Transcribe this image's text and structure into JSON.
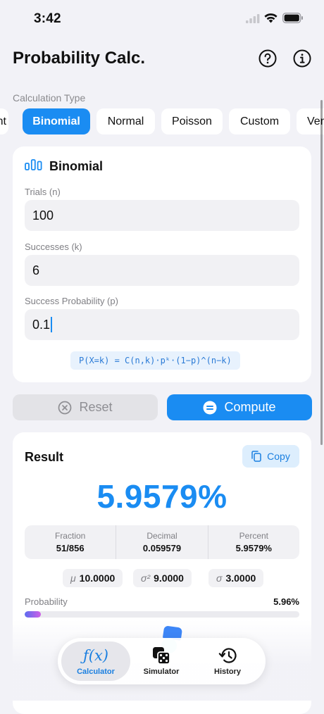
{
  "status_bar": {
    "time": "3:42"
  },
  "header": {
    "title": "Probability Calc."
  },
  "calc_type": {
    "label": "Calculation Type",
    "tabs": [
      "nt",
      "Binomial",
      "Normal",
      "Poisson",
      "Custom",
      "Ven"
    ],
    "selected": "Binomial"
  },
  "input_card": {
    "title": "Binomial",
    "fields": [
      {
        "label": "Trials (n)",
        "value": "100"
      },
      {
        "label": "Successes (k)",
        "value": "6"
      },
      {
        "label": "Success Probability (p)",
        "value": "0.1"
      }
    ],
    "formula": "P(X=k) = C(n,k)·pᵏ·(1−p)^(n−k)"
  },
  "actions": {
    "reset_label": "Reset",
    "compute_label": "Compute"
  },
  "result": {
    "title": "Result",
    "copy_label": "Copy",
    "value": "5.9579%",
    "formats": [
      {
        "label": "Fraction",
        "value": "51/856"
      },
      {
        "label": "Decimal",
        "value": "0.059579"
      },
      {
        "label": "Percent",
        "value": "5.9579%"
      }
    ],
    "stats": {
      "mu": {
        "symbol": "μ",
        "value": "10.0000"
      },
      "variance": {
        "symbol": "σ²",
        "value": "9.0000"
      },
      "sd": {
        "symbol": "σ",
        "value": "3.0000"
      }
    },
    "probability_label": "Probability",
    "probability_display": "5.96%",
    "probability_fraction": 0.0596
  },
  "tabbar": {
    "items": [
      {
        "label": "Calculator",
        "icon": "function-icon"
      },
      {
        "label": "Simulator",
        "icon": "dice-icon"
      },
      {
        "label": "History",
        "icon": "history-icon"
      }
    ],
    "active": "Calculator"
  },
  "colors": {
    "accent": "#1a8cf2",
    "background": "#f2f2f7",
    "card": "#ffffff"
  }
}
